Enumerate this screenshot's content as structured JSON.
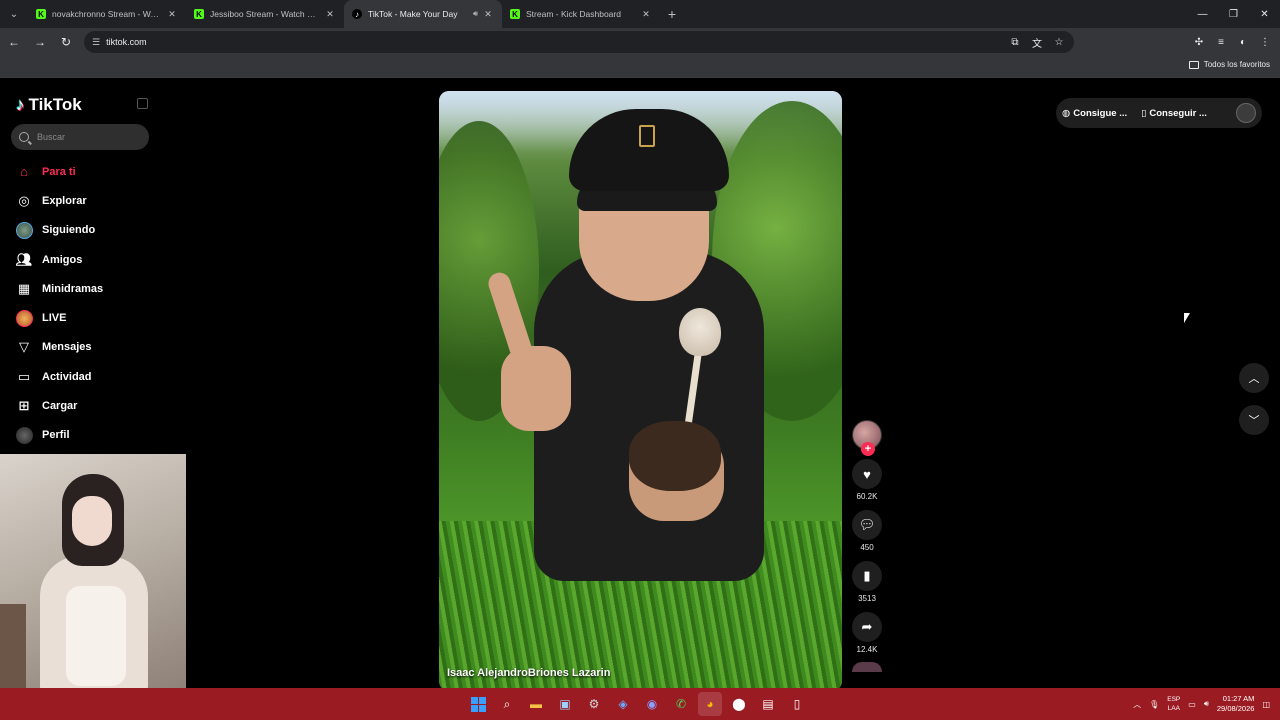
{
  "browser": {
    "tabs": [
      {
        "title": "novakchronno Stream - Watch Live",
        "favicon": "kick-icon",
        "active": false
      },
      {
        "title": "Jessiboo Stream - Watch Live on Kick",
        "favicon": "kick-icon",
        "active": false
      },
      {
        "title": "TikTok - Make Your Day",
        "favicon": "tiktok-icon",
        "active": true
      },
      {
        "title": "Stream - Kick Dashboard",
        "favicon": "kick-icon",
        "active": false
      }
    ],
    "url": "tiktok.com",
    "bookmarks_all": "Todos los favoritos"
  },
  "tiktok": {
    "logo_text": "TikTok",
    "search_placeholder": "Buscar",
    "nav": [
      {
        "label": "Para ti",
        "icon": "home-icon",
        "active": true
      },
      {
        "label": "Explorar",
        "icon": "compass-icon",
        "active": false
      },
      {
        "label": "Siguiendo",
        "icon": "following-avatar-icon",
        "active": false
      },
      {
        "label": "Amigos",
        "icon": "friends-icon",
        "active": false
      },
      {
        "label": "Minidramas",
        "icon": "film-icon",
        "active": false
      },
      {
        "label": "LIVE",
        "icon": "live-icon",
        "active": false
      },
      {
        "label": "Mensajes",
        "icon": "send-icon",
        "active": false
      },
      {
        "label": "Actividad",
        "icon": "inbox-icon",
        "active": false
      },
      {
        "label": "Cargar",
        "icon": "upload-icon",
        "active": false
      },
      {
        "label": "Perfil",
        "icon": "profile-avatar-icon",
        "active": false
      }
    ],
    "video": {
      "author": "Isaac AlejandroBriones Lazarin"
    },
    "actions": {
      "likes": "60.2K",
      "comments": "450",
      "saves": "3513",
      "shares": "12.4K"
    },
    "get_app": {
      "coins_label": "Consigue ...",
      "app_label": "Conseguir ..."
    }
  },
  "taskbar": {
    "language_top": "ESP",
    "language_bottom": "LAA",
    "time": "01:27 AM",
    "date": "29/08/2026"
  },
  "colors": {
    "accent": "#fe2c55",
    "taskbar": "#9b1b22",
    "chrome_dark": "#202124"
  }
}
